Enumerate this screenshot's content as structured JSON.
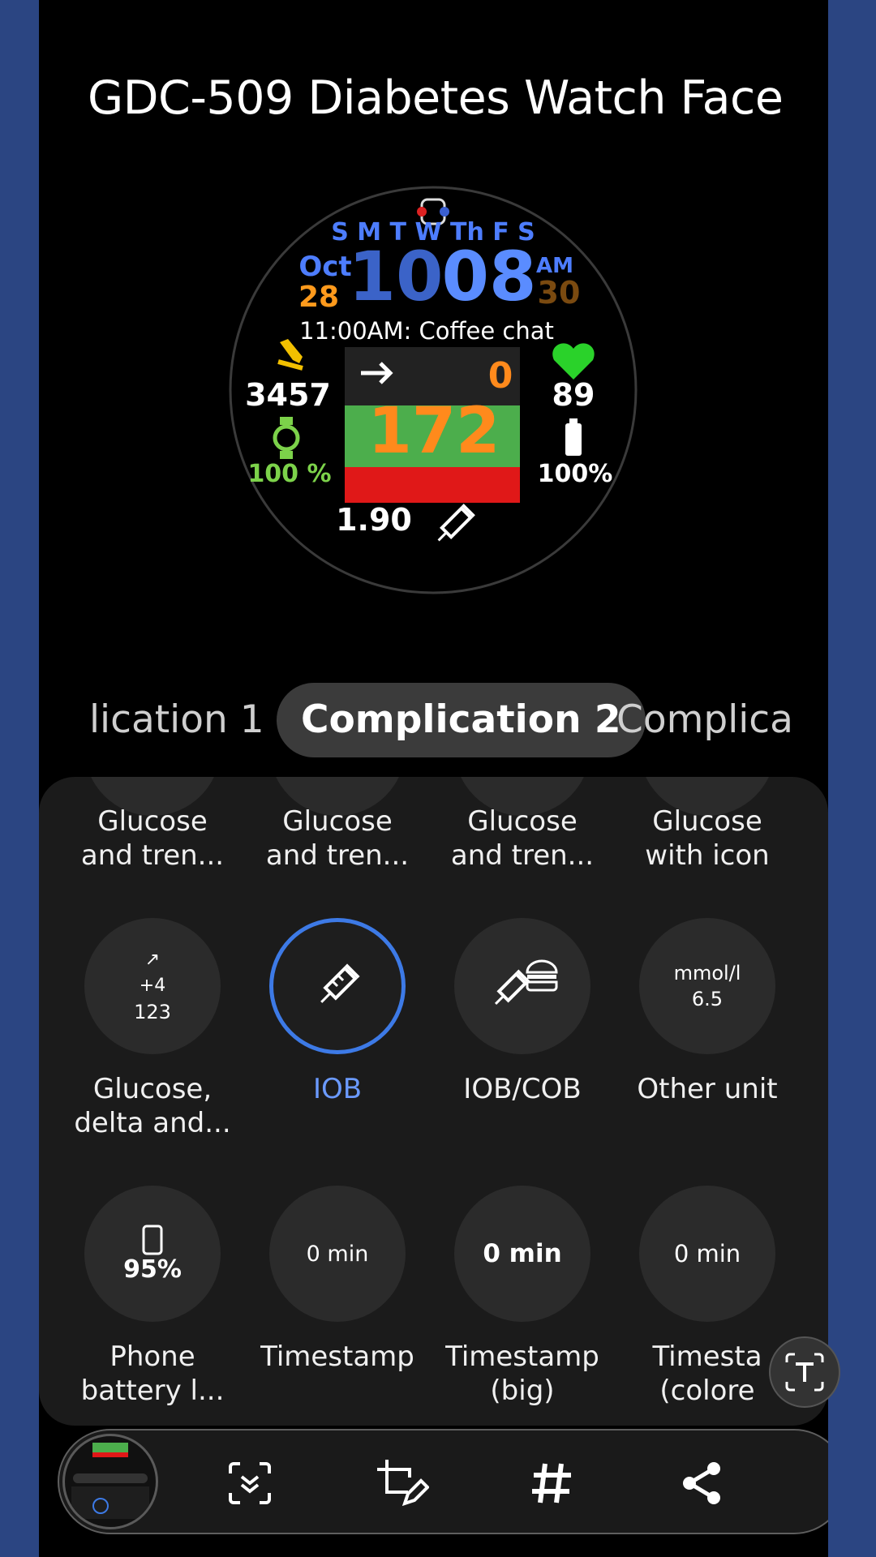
{
  "title": "GDC-509 Diabetes Watch Face",
  "watch": {
    "days": "S M T W Th F S",
    "month": "Oct",
    "day": "28",
    "hour": "10",
    "minute": "08",
    "ampm": "AM",
    "seconds": "30",
    "event": "11:00AM: Coffee chat",
    "steps": "3457",
    "watch_battery": "100 %",
    "heart_rate": "89",
    "phone_battery": "100%",
    "trend_value": "0",
    "glucose": "172",
    "iob": "1.90"
  },
  "tabs": [
    {
      "label": "lication 1"
    },
    {
      "label": "Complication 2"
    },
    {
      "label": "Complica"
    }
  ],
  "grid": {
    "row0": [
      {
        "label1": "Glucose",
        "label2": "and tren..."
      },
      {
        "label1": "Glucose",
        "label2": "and tren..."
      },
      {
        "label1": "Glucose",
        "label2": "and tren..."
      },
      {
        "label1": "Glucose",
        "label2": "with icon"
      }
    ],
    "row1": [
      {
        "arrow": "↗",
        "delta": "+4",
        "value": "123",
        "label1": "Glucose,",
        "label2": "delta and..."
      },
      {
        "label1": "IOB",
        "label2": ""
      },
      {
        "label1": "IOB/COB",
        "label2": ""
      },
      {
        "unit": "mmol/l",
        "value": "6.5",
        "label1": "Other unit",
        "label2": ""
      }
    ],
    "row2": [
      {
        "value": "95%",
        "label1": "Phone",
        "label2": "battery l..."
      },
      {
        "value": "0 min",
        "label1": "Timestamp",
        "label2": ""
      },
      {
        "value": "0 min",
        "label1": "Timestamp",
        "label2": "(big)"
      },
      {
        "value": "0 min",
        "label1": "Timesta",
        "label2": "(colore"
      }
    ]
  },
  "colors": {
    "accent": "#3d7ae6",
    "glucose_orange": "#ff8a1c",
    "green_zone": "#4cae4c",
    "red_zone": "#e01818",
    "date_blue": "#3d6fd6"
  }
}
